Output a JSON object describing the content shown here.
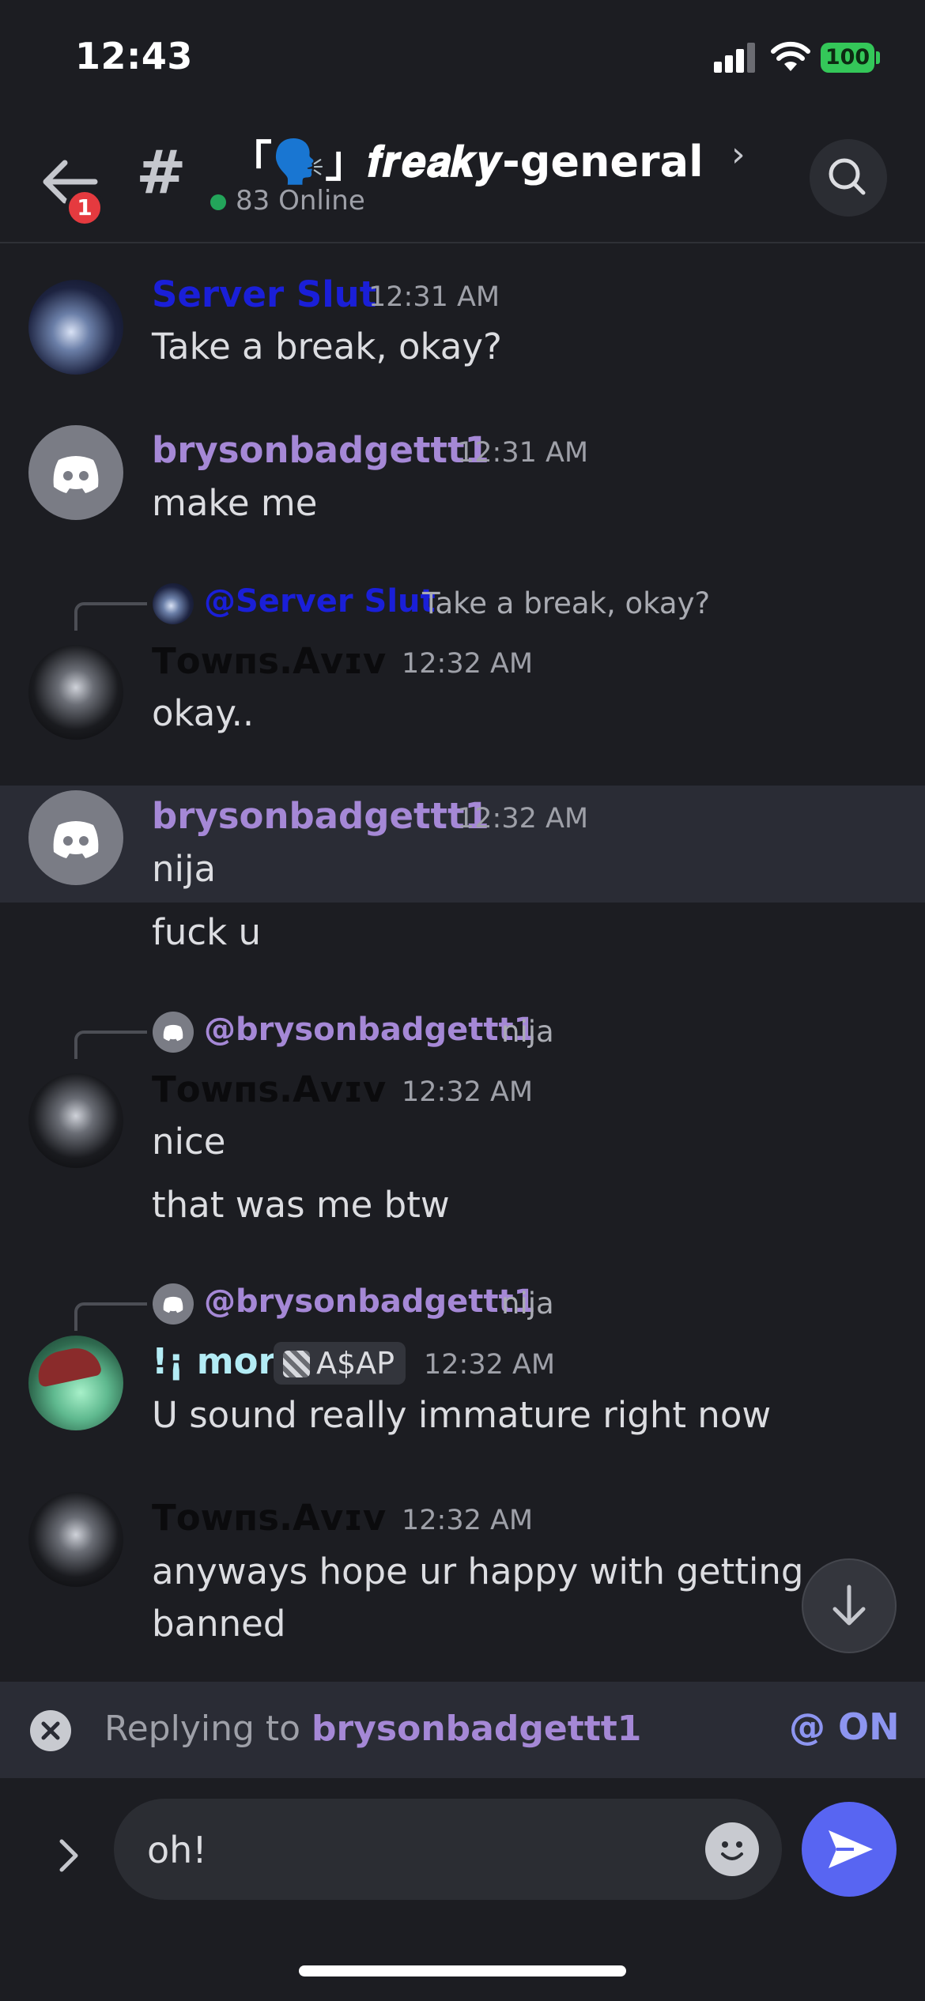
{
  "status_bar": {
    "time": "12:43",
    "battery": "100"
  },
  "header": {
    "notification_count": "1",
    "channel_name": "「🗣️」𝒇𝒓𝒆𝒂𝒌𝒚-general",
    "online_count": "83 Online"
  },
  "messages": [
    {
      "username": "Server Slut",
      "username_color": "#1a1fd8",
      "timestamp": "12:31 AM",
      "lines": [
        "Take a break, okay?"
      ]
    },
    {
      "username": "brysonbadgettt1",
      "username_color": "#a588d6",
      "timestamp": "12:31 AM",
      "lines": [
        "make me"
      ]
    },
    {
      "reply": {
        "user": "@Server Slut",
        "user_color": "#1a1fd8",
        "snippet": "Take a break, okay?"
      },
      "username": "Тᴏᴡпѕ.Аᴠɪᴠ",
      "username_color": "#0b0b0d",
      "timestamp": "12:32 AM",
      "lines": [
        "okay.."
      ]
    },
    {
      "username": "brysonbadgettt1",
      "username_color": "#a588d6",
      "timestamp": "12:32 AM",
      "lines": [
        "nija",
        "fuck u"
      ]
    },
    {
      "reply": {
        "user": "@brysonbadgettt1",
        "user_color": "#a588d6",
        "snippet": "nija"
      },
      "username": "Тᴏᴡпѕ.Аᴠɪᴠ",
      "username_color": "#0b0b0d",
      "timestamp": "12:32 AM",
      "lines": [
        "nice",
        "that was me btw"
      ]
    },
    {
      "reply": {
        "user": "@brysonbadgettt1",
        "user_color": "#a588d6",
        "snippet": "nija"
      },
      "username": "!¡ mori",
      "username_color": "#b3ecf5",
      "role_tag": "A$AP",
      "timestamp": "12:32 AM",
      "lines": [
        "U sound really immature right now"
      ]
    },
    {
      "username": "Тᴏᴡпѕ.Аᴠɪᴠ",
      "username_color": "#0b0b0d",
      "timestamp": "12:32 AM",
      "lines": [
        "anyways hope ur happy with getting",
        "banned"
      ]
    }
  ],
  "reply_bar": {
    "prefix": "Replying to ",
    "target": "brysonbadgettt1",
    "mention_toggle": "@ ON"
  },
  "composer": {
    "input_value": "oh!"
  },
  "colors": {
    "accent": "#5865f2",
    "online": "#23a55a",
    "badge": "#e53a3f",
    "background": "#1c1d22"
  },
  "icons": [
    "back-arrow-icon",
    "hash-icon",
    "chevron-right-icon",
    "search-icon",
    "discord-icon",
    "arrow-down-icon",
    "close-icon",
    "chevron-right-icon",
    "emoji-icon",
    "send-icon"
  ]
}
